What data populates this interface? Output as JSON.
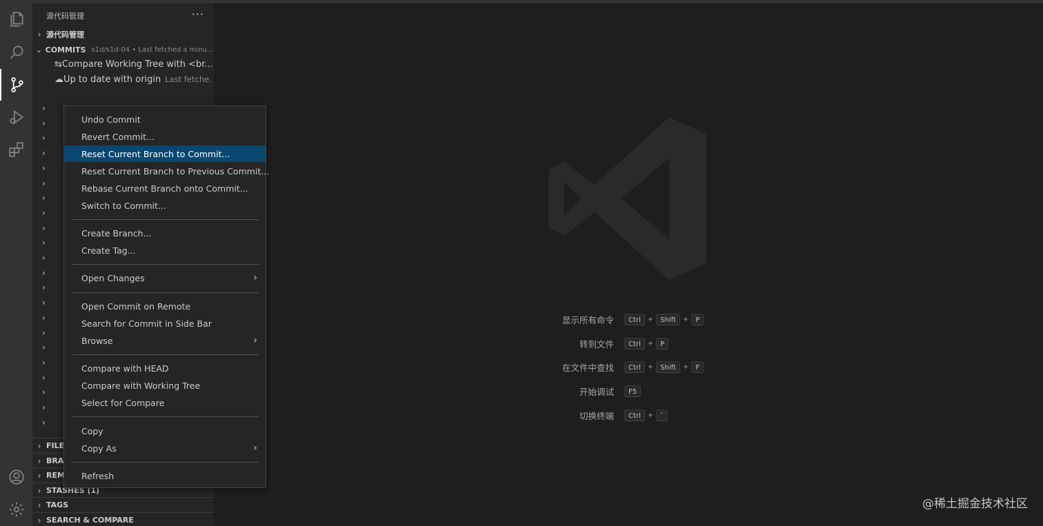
{
  "sidebar": {
    "title": "源代码管理",
    "more_label": "···",
    "sections": {
      "scm": "源代码管理",
      "commits": "COMMITS",
      "commits_desc": "s1d/s1d-04 • Last fetched a minute ...",
      "file": "FILE",
      "branches": "BRAI",
      "remotes": "REM",
      "stashes": "STASHES (1)",
      "tags": "TAGS",
      "search_compare": "SEARCH & COMPARE"
    },
    "rows": {
      "compare": "Compare Working Tree with <br...",
      "uptodate": "Up to date with origin",
      "uptodate_sub": "Last fetche..."
    }
  },
  "menu": {
    "items": [
      {
        "label": "Undo Commit"
      },
      {
        "label": "Revert Commit..."
      },
      {
        "label": "Reset Current Branch to Commit..."
      },
      {
        "label": "Reset Current Branch to Previous Commit..."
      },
      {
        "label": "Rebase Current Branch onto Commit..."
      },
      {
        "label": "Switch to Commit..."
      },
      {
        "label": "Create Branch..."
      },
      {
        "label": "Create Tag..."
      },
      {
        "label": "Open Changes"
      },
      {
        "label": "Open Commit on Remote"
      },
      {
        "label": "Search for Commit in Side Bar"
      },
      {
        "label": "Browse"
      },
      {
        "label": "Compare with HEAD"
      },
      {
        "label": "Compare with Working Tree"
      },
      {
        "label": "Select for Compare"
      },
      {
        "label": "Copy"
      },
      {
        "label": "Copy As"
      },
      {
        "label": "Refresh"
      }
    ],
    "highlighted": "Reset Current Branch to Commit..."
  },
  "editor": {
    "shortcuts": [
      {
        "label": "显示所有命令",
        "keys": [
          "Ctrl",
          "Shift",
          "P"
        ]
      },
      {
        "label": "转到文件",
        "keys": [
          "Ctrl",
          "P"
        ]
      },
      {
        "label": "在文件中查找",
        "keys": [
          "Ctrl",
          "Shift",
          "F"
        ]
      },
      {
        "label": "开始调试",
        "keys": [
          "F5"
        ]
      },
      {
        "label": "切换终端",
        "keys": [
          "Ctrl",
          "`"
        ]
      }
    ],
    "corner_text": "@稀土掘金技术社区"
  },
  "icons": {
    "activity": [
      "files-icon",
      "search-icon",
      "source-control-icon",
      "run-debug-icon",
      "extensions-icon",
      "account-icon",
      "settings-gear-icon"
    ]
  },
  "colors": {
    "accent_highlight": "#094771",
    "activity_bar": "#333333",
    "sidebar": "#252526",
    "editor": "#1e1e1e"
  }
}
